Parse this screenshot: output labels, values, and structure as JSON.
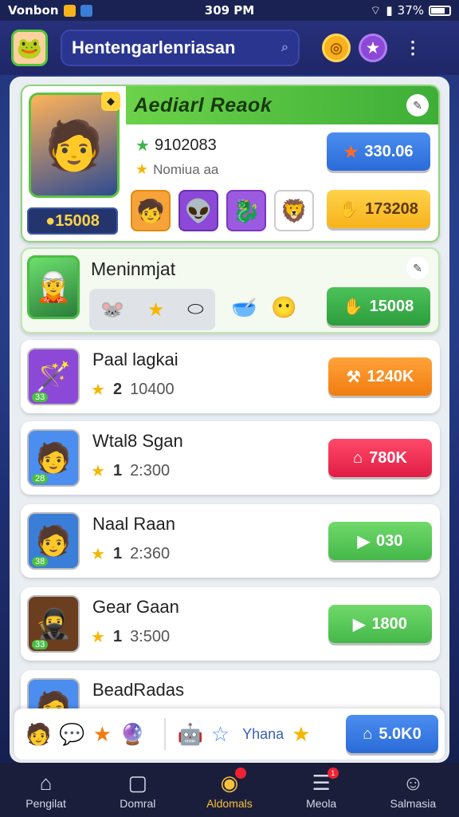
{
  "status_bar": {
    "carrier": "Vonbon",
    "time": "309 PM",
    "battery": "37%"
  },
  "header": {
    "search_text": "Hentengarlenriasan",
    "avatar_icon": "frog-avatar-icon",
    "coin_icon": "coin-icon",
    "star_icon": "star-icon",
    "more_icon": "more-vertical-icon"
  },
  "featured": {
    "title": "Aediarl Reaok",
    "score": "9102083",
    "subtitle": "Nomiua aa",
    "price": "15008",
    "btn_primary": "330.06",
    "btn_secondary": "173208",
    "thumb_icons": [
      "boy-icon",
      "alien-icon",
      "dragon-icon",
      "lion-icon"
    ]
  },
  "second": {
    "title": "Meninmjat",
    "button": "15008",
    "tray_icons": [
      "mouse-icon",
      "star-icon",
      "pill-icon"
    ],
    "extra_icons": [
      "bowl-icon",
      "face-icon"
    ]
  },
  "items": [
    {
      "title": "Paal lagkai",
      "rating": "2",
      "count": "10400",
      "button": "1240K",
      "button_icon": "hammer-icon",
      "level": "33",
      "btn_class": "btn-orange",
      "thumb_bg": "#8c49d8"
    },
    {
      "title": "Wtal8 Sgan",
      "rating": "1",
      "count": "2:300",
      "button": "780K",
      "button_icon": "house-icon",
      "level": "28",
      "btn_class": "btn-red",
      "thumb_bg": "#4c8df0"
    },
    {
      "title": "Naal Raan",
      "rating": "1",
      "count": "2:360",
      "button": "030",
      "button_icon": "play-icon",
      "level": "38",
      "btn_class": "btn-lgreen",
      "thumb_bg": "#3b7ed8"
    },
    {
      "title": "Gear Gaan",
      "rating": "1",
      "count": "3:500",
      "button": "1800",
      "button_icon": "play-icon",
      "level": "33",
      "btn_class": "btn-lgreen",
      "thumb_bg": "#6b3e20"
    },
    {
      "title": "BeadRadas",
      "rating": "",
      "count": "",
      "button": "",
      "button_icon": "",
      "level": "",
      "btn_class": "btn-lgreen",
      "thumb_bg": "#4c8df0"
    }
  ],
  "dock": {
    "label": "Yhana",
    "button": "5.0K0"
  },
  "nav": [
    {
      "label": "Pengilat",
      "icon": "home-icon",
      "active": false
    },
    {
      "label": "Domral",
      "icon": "square-icon",
      "active": false
    },
    {
      "label": "Aldomals",
      "icon": "circle-icon",
      "active": true
    },
    {
      "label": "Meola",
      "icon": "stack-icon",
      "active": false
    },
    {
      "label": "Salmasia",
      "icon": "profile-icon",
      "active": false
    }
  ],
  "colors": {
    "accent_green": "#3dae37",
    "nav_bg": "#1b1e3a",
    "header_bg": "#1f2768"
  }
}
